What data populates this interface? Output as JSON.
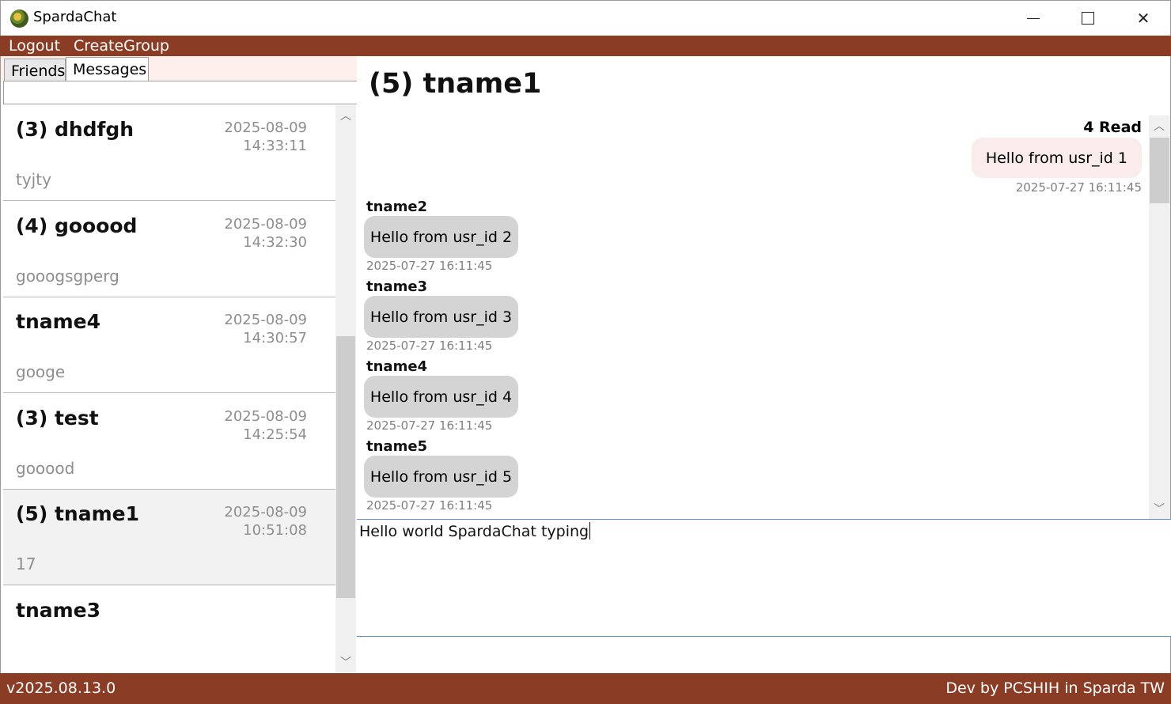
{
  "window": {
    "title": "SpardaChat"
  },
  "menu": {
    "logout": "Logout",
    "create_group": "CreateGroup"
  },
  "tabs": {
    "friends": "Friends",
    "messages": "Messages"
  },
  "chat_list": [
    {
      "name": "(3) dhdfgh",
      "date": "2025-08-09",
      "time": "14:33:11",
      "preview": "tyjty"
    },
    {
      "name": "(4) gooood",
      "date": "2025-08-09",
      "time": "14:32:30",
      "preview": "gooogsgperg"
    },
    {
      "name": "tname4",
      "date": "2025-08-09",
      "time": "14:30:57",
      "preview": "googe"
    },
    {
      "name": "(3) test",
      "date": "2025-08-09",
      "time": "14:25:54",
      "preview": "gooood"
    },
    {
      "name": "(5) tname1",
      "date": "2025-08-09",
      "time": "10:51:08",
      "preview": "17"
    },
    {
      "name": "tname3",
      "date": "",
      "time": "",
      "preview": ""
    }
  ],
  "conversation": {
    "title": "(5) tname1",
    "read_label": "4 Read",
    "outgoing": {
      "text": "Hello from usr_id 1",
      "time": "2025-07-27 16:11:45"
    },
    "incoming": [
      {
        "sender": "tname2",
        "text": "Hello from usr_id 2",
        "time": "2025-07-27 16:11:45"
      },
      {
        "sender": "tname3",
        "text": "Hello from usr_id 3",
        "time": "2025-07-27 16:11:45"
      },
      {
        "sender": "tname4",
        "text": "Hello from usr_id 4",
        "time": "2025-07-27 16:11:45"
      },
      {
        "sender": "tname5",
        "text": "Hello from usr_id 5",
        "time": "2025-07-27 16:11:45"
      }
    ],
    "input_value": "Hello world SpardaChat typing"
  },
  "status": {
    "version": "v2025.08.13.0",
    "credit": "Dev by PCSHIH in Sparda TW"
  },
  "colors": {
    "brand": "#8b3c24",
    "tab_strip": "#fcefec",
    "bubble_out": "#f9ecea",
    "bubble_in": "#d4d4d4"
  }
}
